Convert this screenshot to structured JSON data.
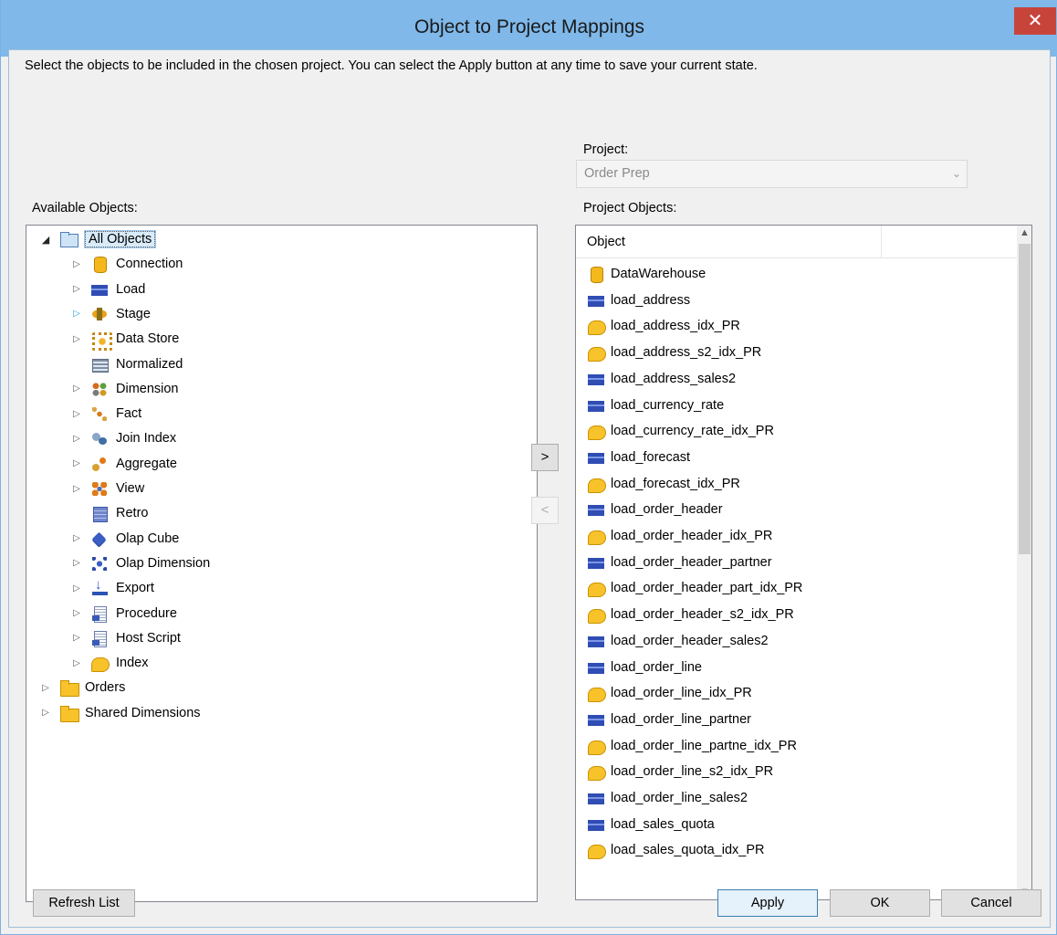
{
  "window": {
    "title": "Object to Project Mappings",
    "close_glyph": "✕"
  },
  "instructions": "Select the objects to be included in the chosen project. You can select the Apply button at any time to save your current state.",
  "project": {
    "label": "Project:",
    "selected": "Order Prep"
  },
  "available": {
    "label": "Available Objects:",
    "tree": [
      {
        "label": "All Objects",
        "icon": "folder-blue-icon",
        "level": 0,
        "expander": "open",
        "selected": true
      },
      {
        "label": "Connection",
        "icon": "connection-icon",
        "level": 1,
        "expander": "closed"
      },
      {
        "label": "Load",
        "icon": "load-table-icon",
        "level": 1,
        "expander": "closed"
      },
      {
        "label": "Stage",
        "icon": "stage-icon",
        "level": 1,
        "expander": "hover"
      },
      {
        "label": "Data Store",
        "icon": "data-store-icon",
        "level": 1,
        "expander": "closed"
      },
      {
        "label": "Normalized",
        "icon": "normalized-icon",
        "level": 1,
        "expander": "none"
      },
      {
        "label": "Dimension",
        "icon": "dimension-icon",
        "level": 1,
        "expander": "closed"
      },
      {
        "label": "Fact",
        "icon": "fact-icon",
        "level": 1,
        "expander": "closed"
      },
      {
        "label": "Join Index",
        "icon": "join-index-icon",
        "level": 1,
        "expander": "closed"
      },
      {
        "label": "Aggregate",
        "icon": "aggregate-icon",
        "level": 1,
        "expander": "closed"
      },
      {
        "label": "View",
        "icon": "view-icon",
        "level": 1,
        "expander": "closed"
      },
      {
        "label": "Retro",
        "icon": "retro-icon",
        "level": 1,
        "expander": "none"
      },
      {
        "label": "Olap Cube",
        "icon": "olap-cube-icon",
        "level": 1,
        "expander": "closed"
      },
      {
        "label": "Olap Dimension",
        "icon": "olap-dimension-icon",
        "level": 1,
        "expander": "closed"
      },
      {
        "label": "Export",
        "icon": "export-icon",
        "level": 1,
        "expander": "closed"
      },
      {
        "label": "Procedure",
        "icon": "procedure-icon",
        "level": 1,
        "expander": "closed"
      },
      {
        "label": "Host Script",
        "icon": "host-script-icon",
        "level": 1,
        "expander": "closed"
      },
      {
        "label": "Index",
        "icon": "index-icon",
        "level": 1,
        "expander": "closed"
      },
      {
        "label": "Orders",
        "icon": "folder-icon",
        "level": 0,
        "expander": "closed"
      },
      {
        "label": "Shared Dimensions",
        "icon": "folder-icon",
        "level": 0,
        "expander": "closed"
      }
    ]
  },
  "project_objects": {
    "label": "Project Objects:",
    "column_header": "Object",
    "items": [
      {
        "name": "DataWarehouse",
        "icon": "connection-icon"
      },
      {
        "name": "load_address",
        "icon": "load-table-icon"
      },
      {
        "name": "load_address_idx_PR",
        "icon": "index-icon"
      },
      {
        "name": "load_address_s2_idx_PR",
        "icon": "index-icon"
      },
      {
        "name": "load_address_sales2",
        "icon": "load-table-icon"
      },
      {
        "name": "load_currency_rate",
        "icon": "load-table-icon"
      },
      {
        "name": "load_currency_rate_idx_PR",
        "icon": "index-icon"
      },
      {
        "name": "load_forecast",
        "icon": "load-table-icon"
      },
      {
        "name": "load_forecast_idx_PR",
        "icon": "index-icon"
      },
      {
        "name": "load_order_header",
        "icon": "load-table-icon"
      },
      {
        "name": "load_order_header_idx_PR",
        "icon": "index-icon"
      },
      {
        "name": "load_order_header_partner",
        "icon": "load-table-icon"
      },
      {
        "name": "load_order_header_part_idx_PR",
        "icon": "index-icon"
      },
      {
        "name": "load_order_header_s2_idx_PR",
        "icon": "index-icon"
      },
      {
        "name": "load_order_header_sales2",
        "icon": "load-table-icon"
      },
      {
        "name": "load_order_line",
        "icon": "load-table-icon"
      },
      {
        "name": "load_order_line_idx_PR",
        "icon": "index-icon"
      },
      {
        "name": "load_order_line_partner",
        "icon": "load-table-icon"
      },
      {
        "name": "load_order_line_partne_idx_PR",
        "icon": "index-icon"
      },
      {
        "name": "load_order_line_s2_idx_PR",
        "icon": "index-icon"
      },
      {
        "name": "load_order_line_sales2",
        "icon": "load-table-icon"
      },
      {
        "name": "load_sales_quota",
        "icon": "load-table-icon"
      },
      {
        "name": "load_sales_quota_idx_PR",
        "icon": "index-icon"
      }
    ]
  },
  "buttons": {
    "add": ">",
    "remove": "<",
    "refresh": "Refresh List",
    "apply": "Apply",
    "ok": "OK",
    "cancel": "Cancel"
  }
}
